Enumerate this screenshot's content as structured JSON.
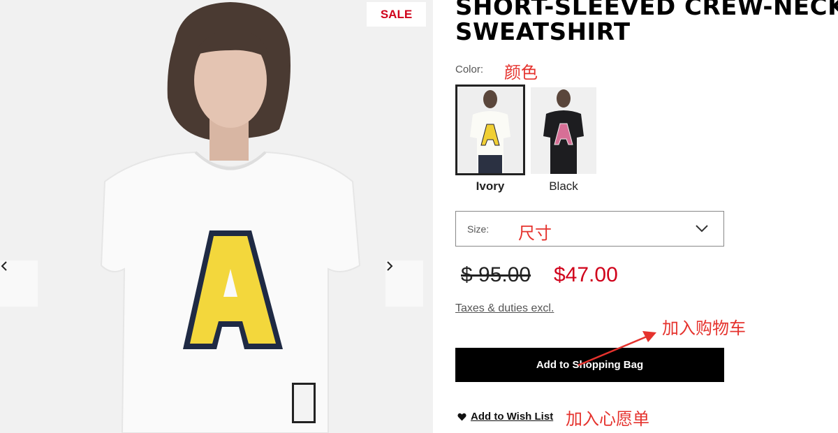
{
  "gallery": {
    "sale_badge": "SALE",
    "prev_icon": "chevron-left-icon",
    "next_icon": "chevron-right-icon"
  },
  "product": {
    "title_line1": "SHORT-SLEEVED CREW-NECK",
    "title_line2": "SWEATSHIRT"
  },
  "color": {
    "label": "Color:",
    "annotation": "颜色",
    "options": [
      {
        "name": "Ivory",
        "selected": true
      },
      {
        "name": "Black",
        "selected": false
      }
    ]
  },
  "size": {
    "label": "Size:",
    "annotation": "尺寸",
    "icon": "chevron-down-icon"
  },
  "price": {
    "original": "$ 95.00",
    "sale": "$47.00"
  },
  "taxes_note": "Taxes & duties excl.",
  "cart": {
    "annotation": "加入购物车",
    "button_label": "Add to Shopping Bag"
  },
  "wishlist": {
    "icon": "heart-icon",
    "label": "Add to Wish List",
    "annotation": "加入心愿单"
  },
  "colors": {
    "sale_red": "#d0021b",
    "annotation_red": "#e5322d",
    "button_black": "#000000"
  }
}
